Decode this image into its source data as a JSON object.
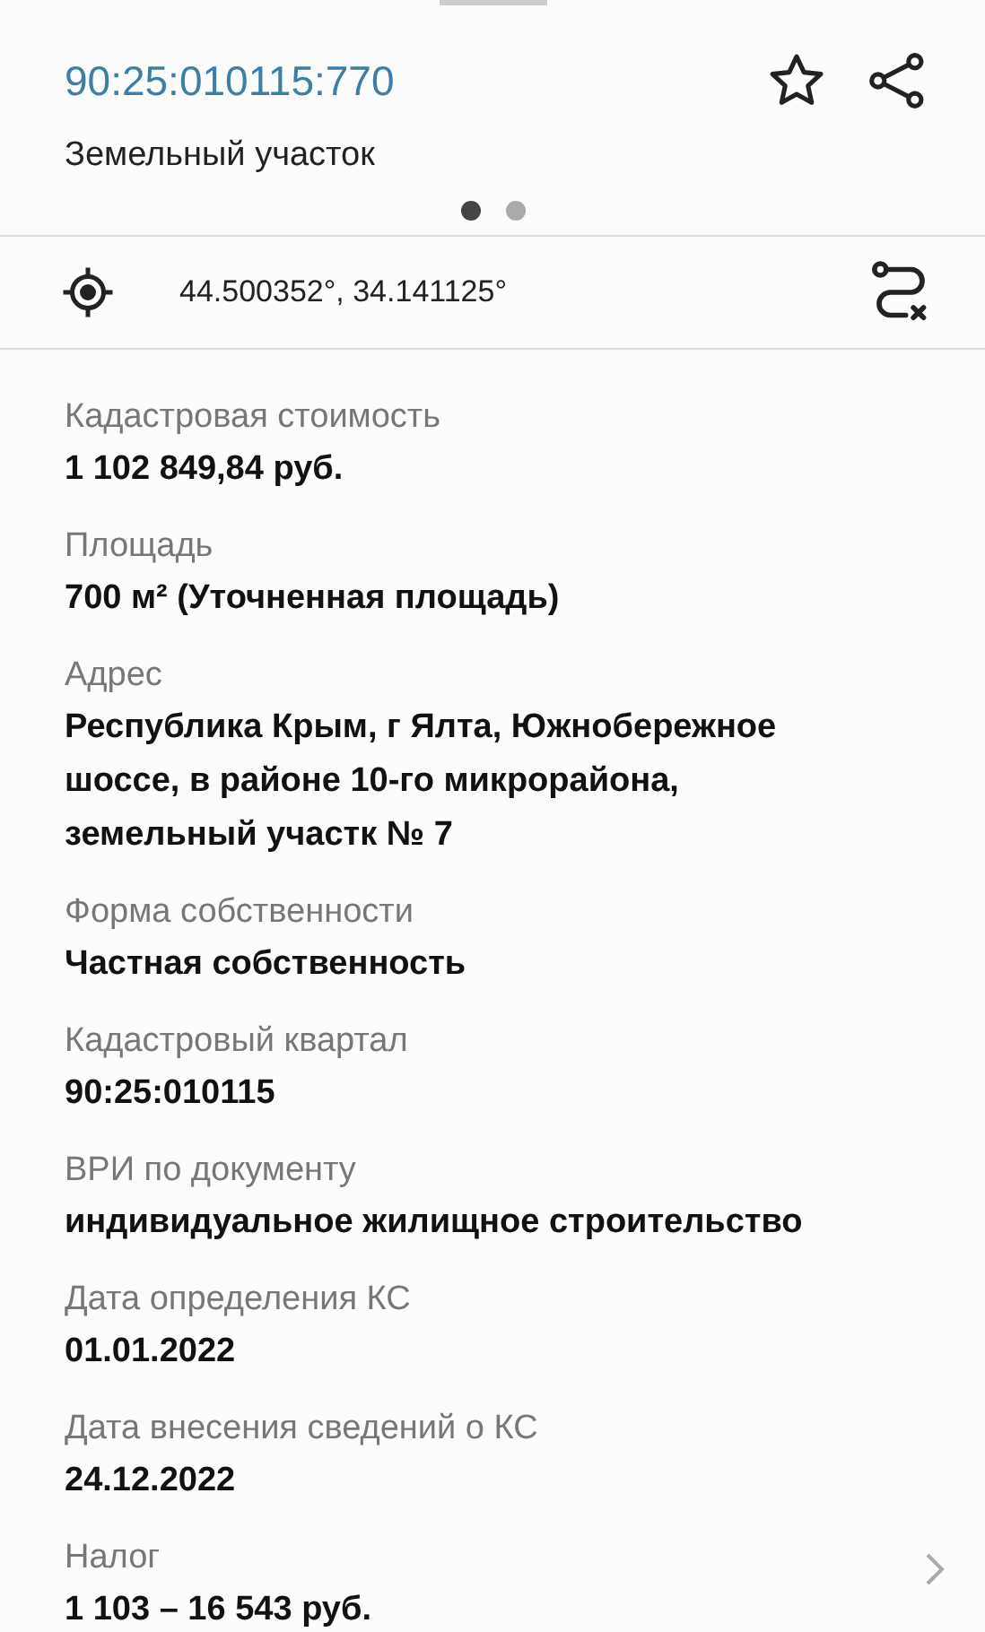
{
  "header": {
    "cadastral_number": "90:25:010115:770",
    "object_type": "Земельный участок",
    "pages": [
      {
        "selected": true
      },
      {
        "selected": false
      }
    ]
  },
  "location": {
    "coordinates": "44.500352°, 34.141125°"
  },
  "fields": [
    {
      "label": "Кадастровая стоимость",
      "value": "1 102 849,84 руб.",
      "link": false
    },
    {
      "label": "Площадь",
      "value": "700 м² (Уточненная площадь)",
      "link": false
    },
    {
      "label": "Адрес",
      "value": "Республика Крым, г Ялта, Южнобережное шоссе, в районе 10-го микрорайона, земельный участк № 7",
      "link": false
    },
    {
      "label": "Форма собственности",
      "value": "Частная собственность",
      "link": false
    },
    {
      "label": "Кадастровый квартал",
      "value": "90:25:010115",
      "link": false
    },
    {
      "label": "ВРИ по документу",
      "value": "индивидуальное жилищное строительство",
      "link": false
    },
    {
      "label": "Дата определения КС",
      "value": "01.01.2022",
      "link": false
    },
    {
      "label": "Дата внесения сведений о КС",
      "value": "24.12.2022",
      "link": false
    },
    {
      "label": "Налог",
      "value": "1 103 – 16 543 руб.",
      "link": true
    }
  ]
}
